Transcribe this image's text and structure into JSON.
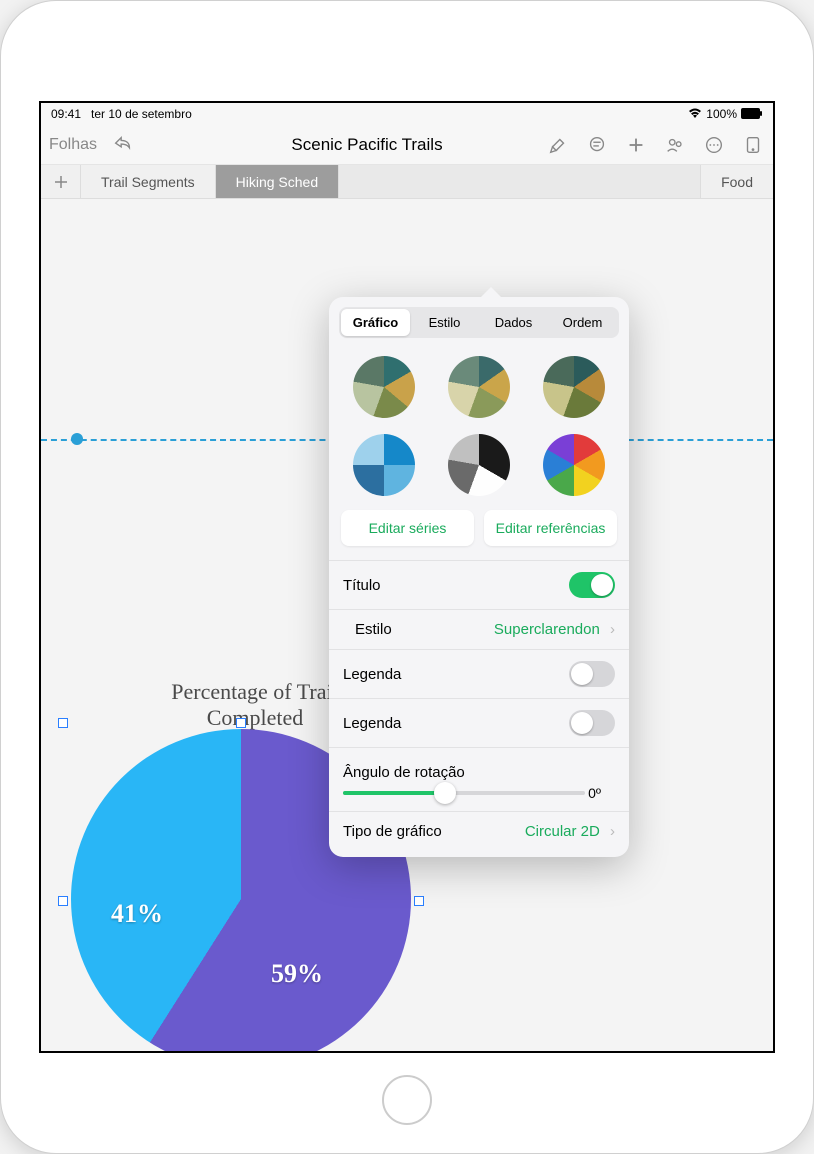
{
  "status": {
    "time": "09:41",
    "date": "ter 10 de setembro",
    "battery": "100%"
  },
  "toolbar": {
    "back_label": "Folhas",
    "title": "Scenic Pacific Trails"
  },
  "tabs": {
    "add": "+",
    "items": [
      {
        "label": "Trail Segments"
      },
      {
        "label": "Hiking Sched"
      }
    ],
    "last": {
      "label": "Food"
    }
  },
  "chart_data": {
    "type": "pie",
    "title": "Percentage of Trail Completed",
    "slices": [
      {
        "label": "59%",
        "value": 59,
        "color": "#6a5acd"
      },
      {
        "label": "41%",
        "value": 41,
        "color": "#29b6f6"
      }
    ]
  },
  "popover": {
    "segments": {
      "grafico": "Gráfico",
      "estilo": "Estilo",
      "dados": "Dados",
      "ordem": "Ordem",
      "selected": "grafico"
    },
    "buttons": {
      "edit_series": "Editar séries",
      "edit_refs": "Editar referências"
    },
    "rows": {
      "titulo": {
        "label": "Título",
        "on": true
      },
      "estilo": {
        "label": "Estilo",
        "value": "Superclarendon"
      },
      "legenda1": {
        "label": "Legenda",
        "on": false
      },
      "legenda2": {
        "label": "Legenda",
        "on": false
      },
      "rotation": {
        "label": "Ângulo de rotação",
        "value": "0º",
        "pct": 42
      },
      "type": {
        "label": "Tipo de gráfico",
        "value": "Circular 2D"
      }
    },
    "swatch_styles": [
      "conic-gradient(#2f6f6f 0 60deg,#c9a24a 60deg 130deg,#7a8a4a 130deg 200deg,#b8c4a0 200deg 280deg,#5a7866 280deg 360deg)",
      "conic-gradient(#3a6a6a 0 55deg,#caa54a 55deg 120deg,#8a9a5a 120deg 200deg,#d8d4aa 200deg 280deg,#6a8a7a 280deg 360deg)",
      "conic-gradient(#2b5b5b 0 55deg,#b88a3a 55deg 120deg,#6a7a3a 120deg 200deg,#c8c48a 200deg 280deg,#4a6a5a 280deg 360deg)",
      "conic-gradient(#1588c9 0 90deg,#5fb4e0 90deg 180deg,#2c6fa0 180deg 270deg,#9ed1ec 270deg 360deg)",
      "conic-gradient(#1a1a1a 0 120deg,#fefefe 120deg 200deg,#6a6a6a 200deg 280deg,#c0c0c0 280deg 360deg)",
      "conic-gradient(#e23b3b 0 60deg,#f29a1f 60deg 120deg,#f2d21f 120deg 180deg,#4aa84a 180deg 240deg,#2a7fd6 240deg 300deg,#7a3fd6 300deg 360deg)"
    ]
  }
}
